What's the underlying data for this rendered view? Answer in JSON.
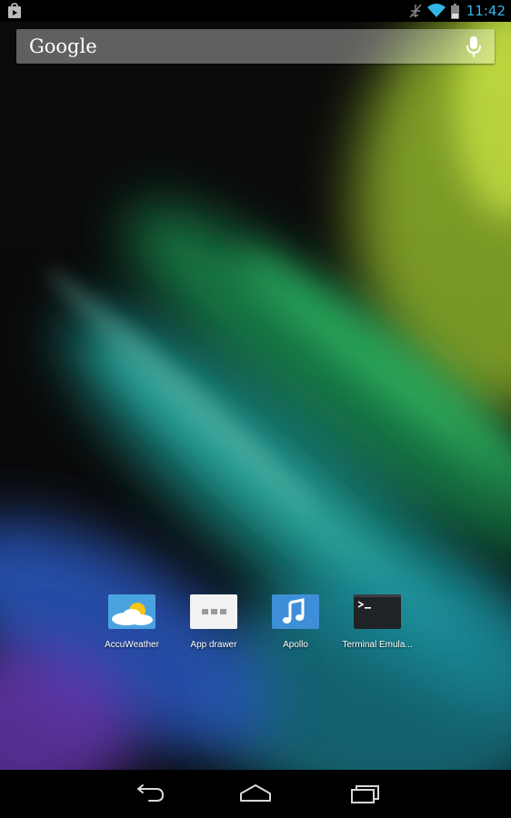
{
  "status_bar": {
    "time": "11:42",
    "time_color": "#33b5e5",
    "left_icons": [
      "store-notification-icon"
    ],
    "right_icons": [
      "airplane-muted-icon",
      "wifi-icon",
      "battery-icon"
    ]
  },
  "search_bar": {
    "logo_text": "Google",
    "mic_icon": "mic-icon"
  },
  "hotseat": {
    "apps": [
      {
        "label": "AccuWeather",
        "icon": "accuweather-icon"
      },
      {
        "label": "App drawer",
        "icon": "app-drawer-icon"
      },
      {
        "label": "Apollo",
        "icon": "music-note-icon"
      },
      {
        "label": "Terminal Emula...",
        "icon": "terminal-icon"
      }
    ]
  },
  "nav_bar": {
    "buttons": [
      "back-icon",
      "home-icon",
      "recent-apps-icon"
    ]
  },
  "colors": {
    "accent": "#33b5e5",
    "wallpaper_dark": "#0b0b0b",
    "wallpaper_green": "#2ecc71",
    "wallpaper_lime": "#c8e63c",
    "wallpaper_blue": "#3a6be0",
    "wallpaper_purple": "#7a3fd0"
  }
}
